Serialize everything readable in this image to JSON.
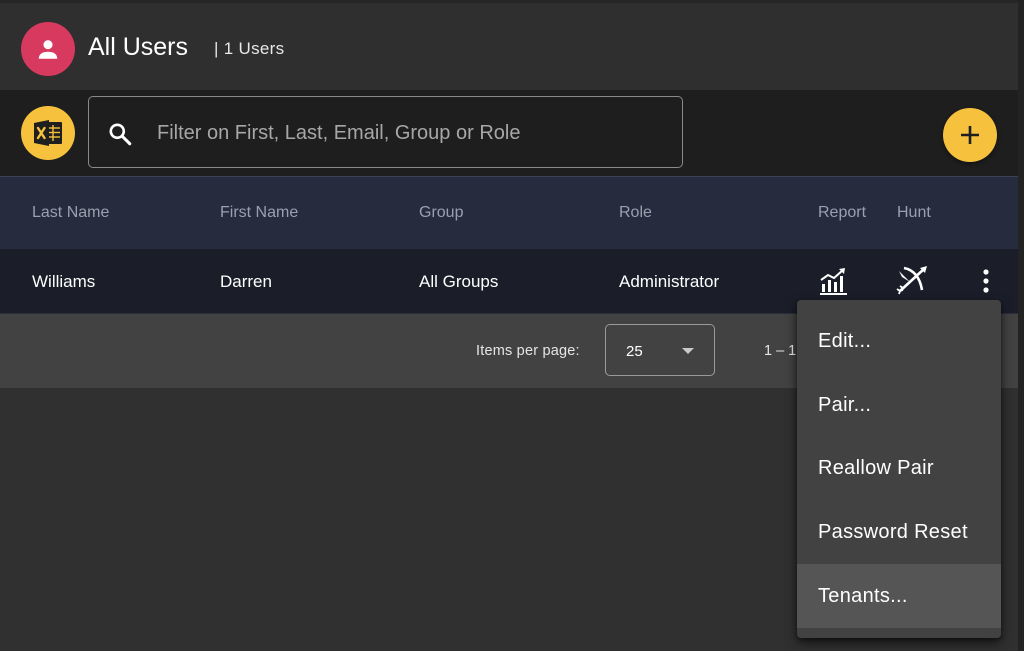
{
  "header": {
    "title": "All Users",
    "count": "| 1 Users",
    "avatar_icon": "person-icon",
    "avatar_color": "#d7395f"
  },
  "toolbar": {
    "export_icon": "excel-icon",
    "search_placeholder": "Filter on First, Last, Email, Group or Role",
    "search_value": "",
    "add_icon": "plus-icon",
    "accent_color": "#f6c23e"
  },
  "table": {
    "columns": [
      "Last Name",
      "First Name",
      "Group",
      "Role",
      "Report",
      "Hunt"
    ],
    "rows": [
      {
        "last_name": "Williams",
        "first_name": "Darren",
        "group": "All Groups",
        "role": "Administrator",
        "report_icon": "bar-chart-icon",
        "hunt_icon": "crossed-target-icon",
        "menu_icon": "more-vertical-icon"
      }
    ]
  },
  "paginator": {
    "items_per_page_label": "Items per page:",
    "items_per_page_value": "25",
    "range_label": "1 – 1"
  },
  "context_menu": {
    "items": [
      {
        "label": "Edit..."
      },
      {
        "label": "Pair..."
      },
      {
        "label": "Reallow Pair"
      },
      {
        "label": "Password Reset"
      },
      {
        "label": "Tenants..."
      }
    ],
    "highlighted_index": 4
  }
}
